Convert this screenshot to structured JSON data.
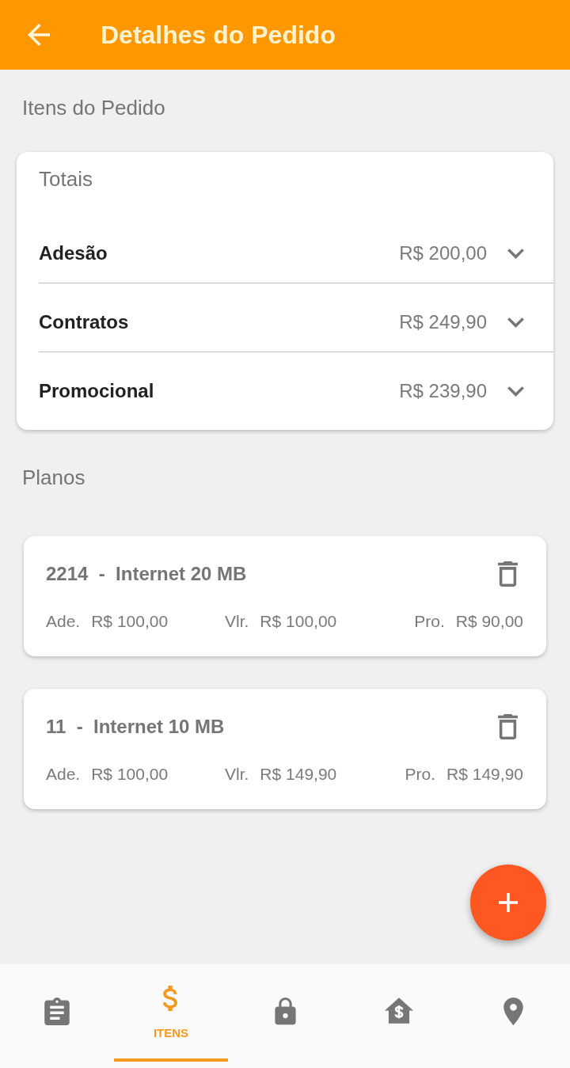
{
  "header": {
    "title": "Detalhes do Pedido"
  },
  "items_section": {
    "title": "Itens do Pedido"
  },
  "totals": {
    "title": "Totais",
    "rows": [
      {
        "label": "Adesão",
        "value": "R$ 200,00",
        "expanded": false
      },
      {
        "label": "Contratos",
        "value": "R$ 249,90",
        "expanded": false
      },
      {
        "label": "Promocional",
        "value": "R$ 239,90",
        "expanded": false
      }
    ]
  },
  "plans_section": {
    "title": "Planos"
  },
  "plans": [
    {
      "title": "2214  -  Internet 20 MB",
      "fields": [
        {
          "label": "Ade.",
          "value": "R$ 100,00"
        },
        {
          "label": "Vlr.",
          "value": "R$ 100,00"
        },
        {
          "label": "Pro.",
          "value": "R$ 90,00"
        }
      ]
    },
    {
      "title": "11  -  Internet 10 MB",
      "fields": [
        {
          "label": "Ade.",
          "value": "R$ 100,00"
        },
        {
          "label": "Vlr.",
          "value": "R$ 149,90"
        },
        {
          "label": "Pro.",
          "value": "R$ 149,90"
        }
      ]
    }
  ],
  "bottom_nav": {
    "tabs": [
      {
        "selected": false
      },
      {
        "label": "ITENS",
        "selected": true
      },
      {
        "selected": false
      },
      {
        "selected": false
      },
      {
        "selected": false
      }
    ]
  }
}
